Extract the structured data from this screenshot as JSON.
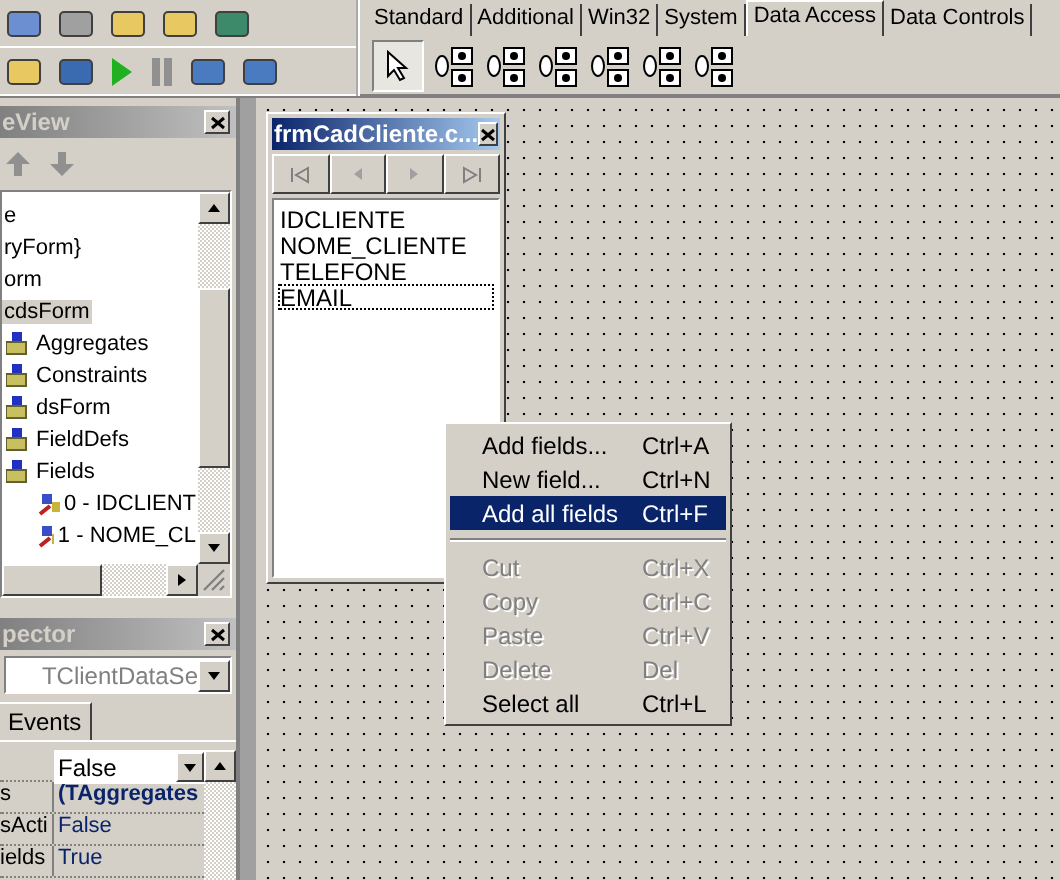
{
  "palette": {
    "tabs": [
      {
        "label": "Standard",
        "selected": false
      },
      {
        "label": "Additional",
        "selected": false
      },
      {
        "label": "Win32",
        "selected": false
      },
      {
        "label": "System",
        "selected": false
      },
      {
        "label": "Data Access",
        "selected": true
      },
      {
        "label": "Data Controls",
        "selected": false
      }
    ]
  },
  "tree_view": {
    "title": "eView",
    "items": [
      {
        "label": "e",
        "selected": false
      },
      {
        "label": "ryForm}",
        "selected": false
      },
      {
        "label": "orm",
        "selected": false
      },
      {
        "label": "cdsForm",
        "selected": true,
        "children": [
          {
            "label": "Aggregates",
            "selected": false
          },
          {
            "label": "Constraints",
            "selected": false
          },
          {
            "label": "dsForm",
            "selected": false
          },
          {
            "label": "FieldDefs",
            "selected": false
          },
          {
            "label": "Fields",
            "selected": false,
            "children": [
              {
                "label": "0 - IDCLIENT",
                "selected": false
              },
              {
                "label": "1 - NOME_CL",
                "selected": false
              }
            ]
          }
        ]
      }
    ]
  },
  "inspector": {
    "title": "pector",
    "object": "TClientDataSe",
    "tabs": [
      {
        "label": "Events",
        "selected": false
      }
    ],
    "rows": [
      {
        "kind": "combo",
        "value": "False"
      },
      {
        "kind": "object",
        "name": "s",
        "value": "(TAggregates"
      },
      {
        "kind": "plain",
        "name": "sActi",
        "value": "False"
      },
      {
        "kind": "plain",
        "name": "ields",
        "value": "True"
      }
    ]
  },
  "fields_editor": {
    "title": "frmCadCliente.c...",
    "fields": [
      {
        "label": "IDCLIENTE",
        "focused": false
      },
      {
        "label": "NOME_CLIENTE",
        "focused": false
      },
      {
        "label": "TELEFONE",
        "focused": false
      },
      {
        "label": "EMAIL",
        "focused": true
      }
    ]
  },
  "context_menu": {
    "items": [
      {
        "kind": "item",
        "label": "Add fields...",
        "shortcut": "Ctrl+A",
        "disabled": false,
        "selected": false
      },
      {
        "kind": "item",
        "label": "New field...",
        "shortcut": "Ctrl+N",
        "disabled": false,
        "selected": false
      },
      {
        "kind": "item",
        "label": "Add all fields",
        "shortcut": "Ctrl+F",
        "disabled": false,
        "selected": true
      },
      {
        "kind": "separator"
      },
      {
        "kind": "item",
        "label": "Cut",
        "shortcut": "Ctrl+X",
        "disabled": true,
        "selected": false
      },
      {
        "kind": "item",
        "label": "Copy",
        "shortcut": "Ctrl+C",
        "disabled": true,
        "selected": false
      },
      {
        "kind": "item",
        "label": "Paste",
        "shortcut": "Ctrl+V",
        "disabled": true,
        "selected": false
      },
      {
        "kind": "item",
        "label": "Delete",
        "shortcut": "Del",
        "disabled": true,
        "selected": false
      },
      {
        "kind": "item",
        "label": "Select all",
        "shortcut": "Ctrl+L",
        "disabled": false,
        "selected": false
      }
    ]
  }
}
